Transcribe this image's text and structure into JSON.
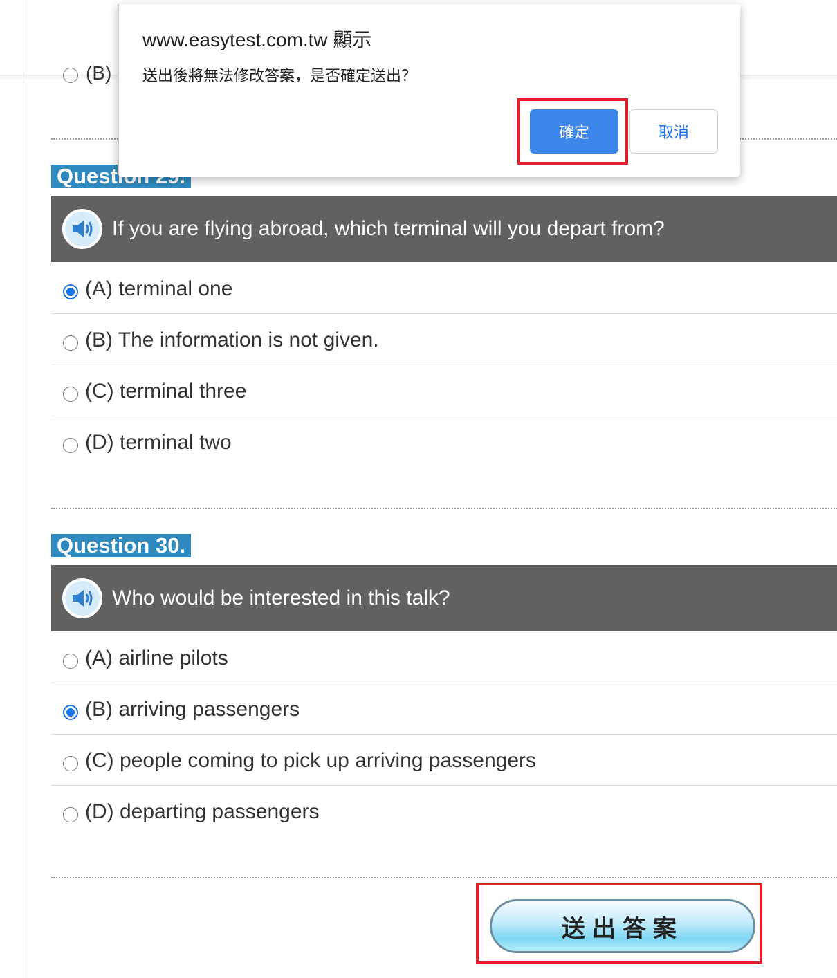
{
  "dialog": {
    "origin": "www.easytest.com.tw 顯示",
    "message": "送出後將無法修改答案，是否確定送出？",
    "ok_label": "確定",
    "cancel_label": "取消"
  },
  "prev_option_label": "(B)",
  "questions": [
    {
      "title": "Question 29.",
      "text": "If you are flying abroad, which terminal will you depart from?",
      "options": [
        {
          "label": "(A) terminal one",
          "checked": true
        },
        {
          "label": "(B) The information is not given.",
          "checked": false
        },
        {
          "label": "(C) terminal three",
          "checked": false
        },
        {
          "label": "(D) terminal two",
          "checked": false
        }
      ]
    },
    {
      "title": "Question 30.",
      "text": "Who would be interested in this talk?",
      "options": [
        {
          "label": "(A) airline pilots",
          "checked": false
        },
        {
          "label": "(B) arriving passengers",
          "checked": true
        },
        {
          "label": "(C) people coming to pick up arriving passengers",
          "checked": false
        },
        {
          "label": "(D) departing passengers",
          "checked": false
        }
      ]
    }
  ],
  "submit_label": "送出答案",
  "colors": {
    "question_title_bg": "#2f8bbf",
    "question_bar_bg": "#616161",
    "radio_checked": "#1a73e8",
    "ok_button": "#3d86ea",
    "highlight": "#e0202a"
  }
}
